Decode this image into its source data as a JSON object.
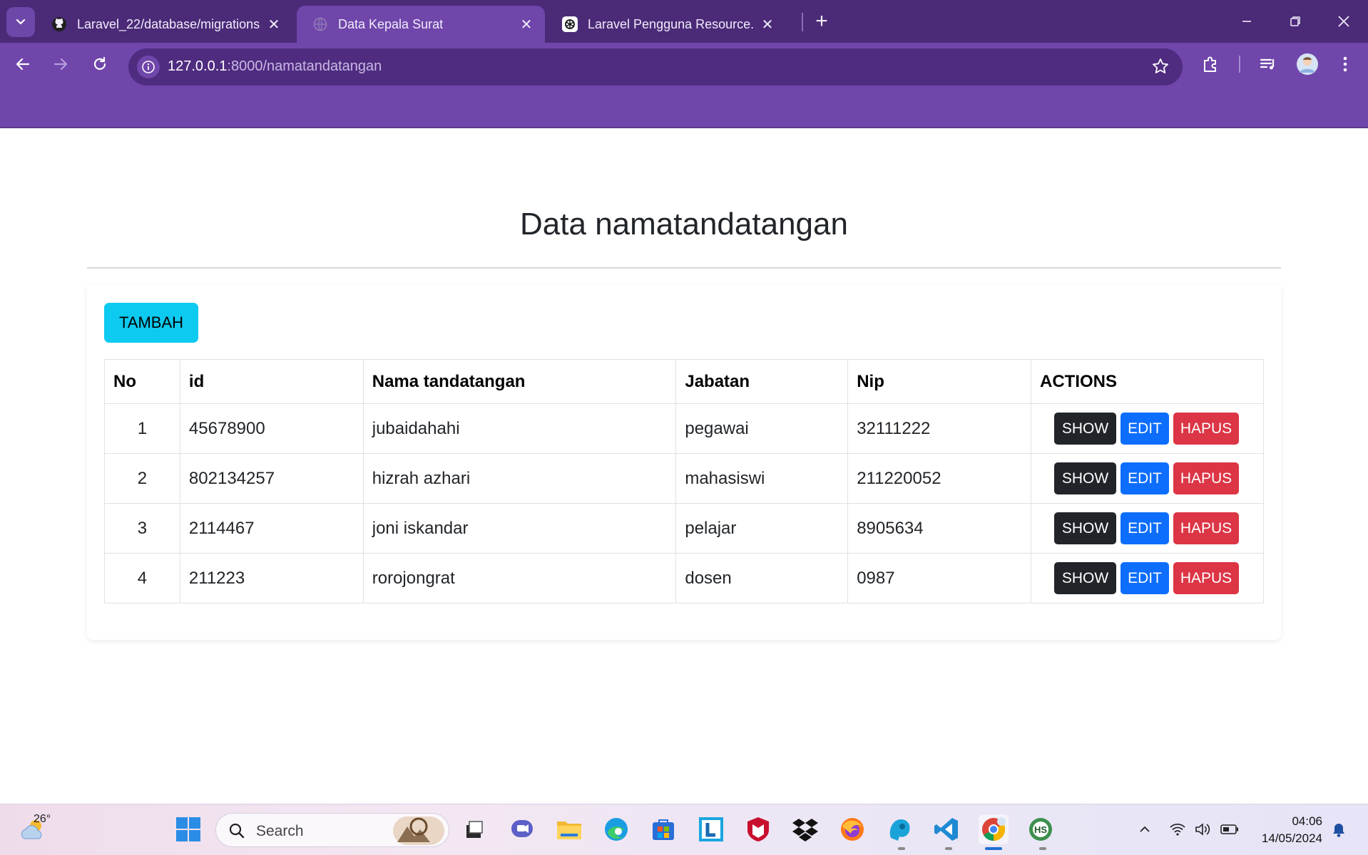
{
  "browser": {
    "tabs": [
      {
        "title": "Laravel_22/database/migrations",
        "favicon": "github-icon",
        "active": false
      },
      {
        "title": "Data Kepala Surat",
        "favicon": "globe-icon",
        "active": true
      },
      {
        "title": "Laravel Pengguna Resource.",
        "favicon": "chatgpt-icon",
        "active": false
      }
    ],
    "url_host": "127.0.0.1",
    "url_path": ":8000/namatandatangan",
    "colors": {
      "frame": "#4b2a78",
      "toolbar": "#7046ab"
    }
  },
  "page": {
    "title": "Data namatandatangan",
    "add_button": "TAMBAH",
    "table": {
      "headers": [
        "No",
        "id",
        "Nama tandatangan",
        "Jabatan",
        "Nip",
        "ACTIONS"
      ],
      "rows": [
        {
          "no": "1",
          "id": "45678900",
          "nama": "jubaidahahi",
          "jabatan": "pegawai",
          "nip": "32111222"
        },
        {
          "no": "2",
          "id": "802134257",
          "nama": "hizrah azhari",
          "jabatan": "mahasiswi",
          "nip": "211220052"
        },
        {
          "no": "3",
          "id": "2114467",
          "nama": "joni iskandar",
          "jabatan": "pelajar",
          "nip": "8905634"
        },
        {
          "no": "4",
          "id": "211223",
          "nama": "rorojongrat",
          "jabatan": "dosen",
          "nip": "0987"
        }
      ],
      "actions": {
        "show": "SHOW",
        "edit": "EDIT",
        "delete": "HAPUS"
      }
    },
    "colors": {
      "add": "#0dcaf0",
      "show": "#212529",
      "edit": "#0d6efd",
      "delete": "#dc3545"
    }
  },
  "taskbar": {
    "weather_temp": "26°",
    "search_placeholder": "Search",
    "time": "04:06",
    "date": "14/05/2024"
  }
}
